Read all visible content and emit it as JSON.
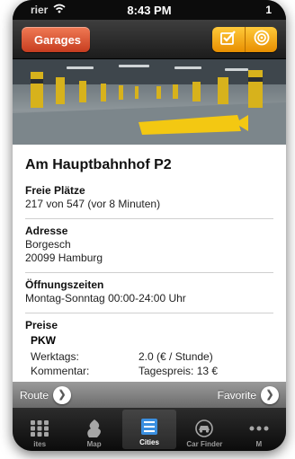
{
  "status": {
    "carrier": "rier",
    "time": "8:43 PM",
    "right": "1"
  },
  "nav": {
    "back_label": "Garages",
    "seg_icons": [
      "checkmark-icon",
      "target-icon"
    ]
  },
  "detail": {
    "title": "Am Hauptbahnhof P2",
    "free_label": "Freie Plätze",
    "free_value": "217 von 547 (vor 8 Minuten)",
    "address_label": "Adresse",
    "address_line1": "Borgesch",
    "address_line2": "20099 Hamburg",
    "hours_label": "Öffnungszeiten",
    "hours_value": "Montag-Sonntag 00:00-24:00 Uhr",
    "prices_label": "Preise",
    "prices_category": "PKW",
    "prices": [
      {
        "key": "Werktags:",
        "value": "2.0 (€ / Stunde)"
      },
      {
        "key": "Kommentar:",
        "value": "Tagespreis: 13 €"
      }
    ]
  },
  "actions": {
    "route_label": "Route",
    "favorite_label": "Favorite"
  },
  "tabs": [
    {
      "label": "ites",
      "icon": "grid-icon"
    },
    {
      "label": "Map",
      "icon": "map-icon"
    },
    {
      "label": "Cities",
      "icon": "list-icon",
      "selected": true
    },
    {
      "label": "Car Finder",
      "icon": "car-icon"
    },
    {
      "label": "M",
      "icon": "more-icon"
    }
  ],
  "colors": {
    "accent": "#e05a34",
    "segment": "#f5a611",
    "tab_bar": "#141414"
  }
}
